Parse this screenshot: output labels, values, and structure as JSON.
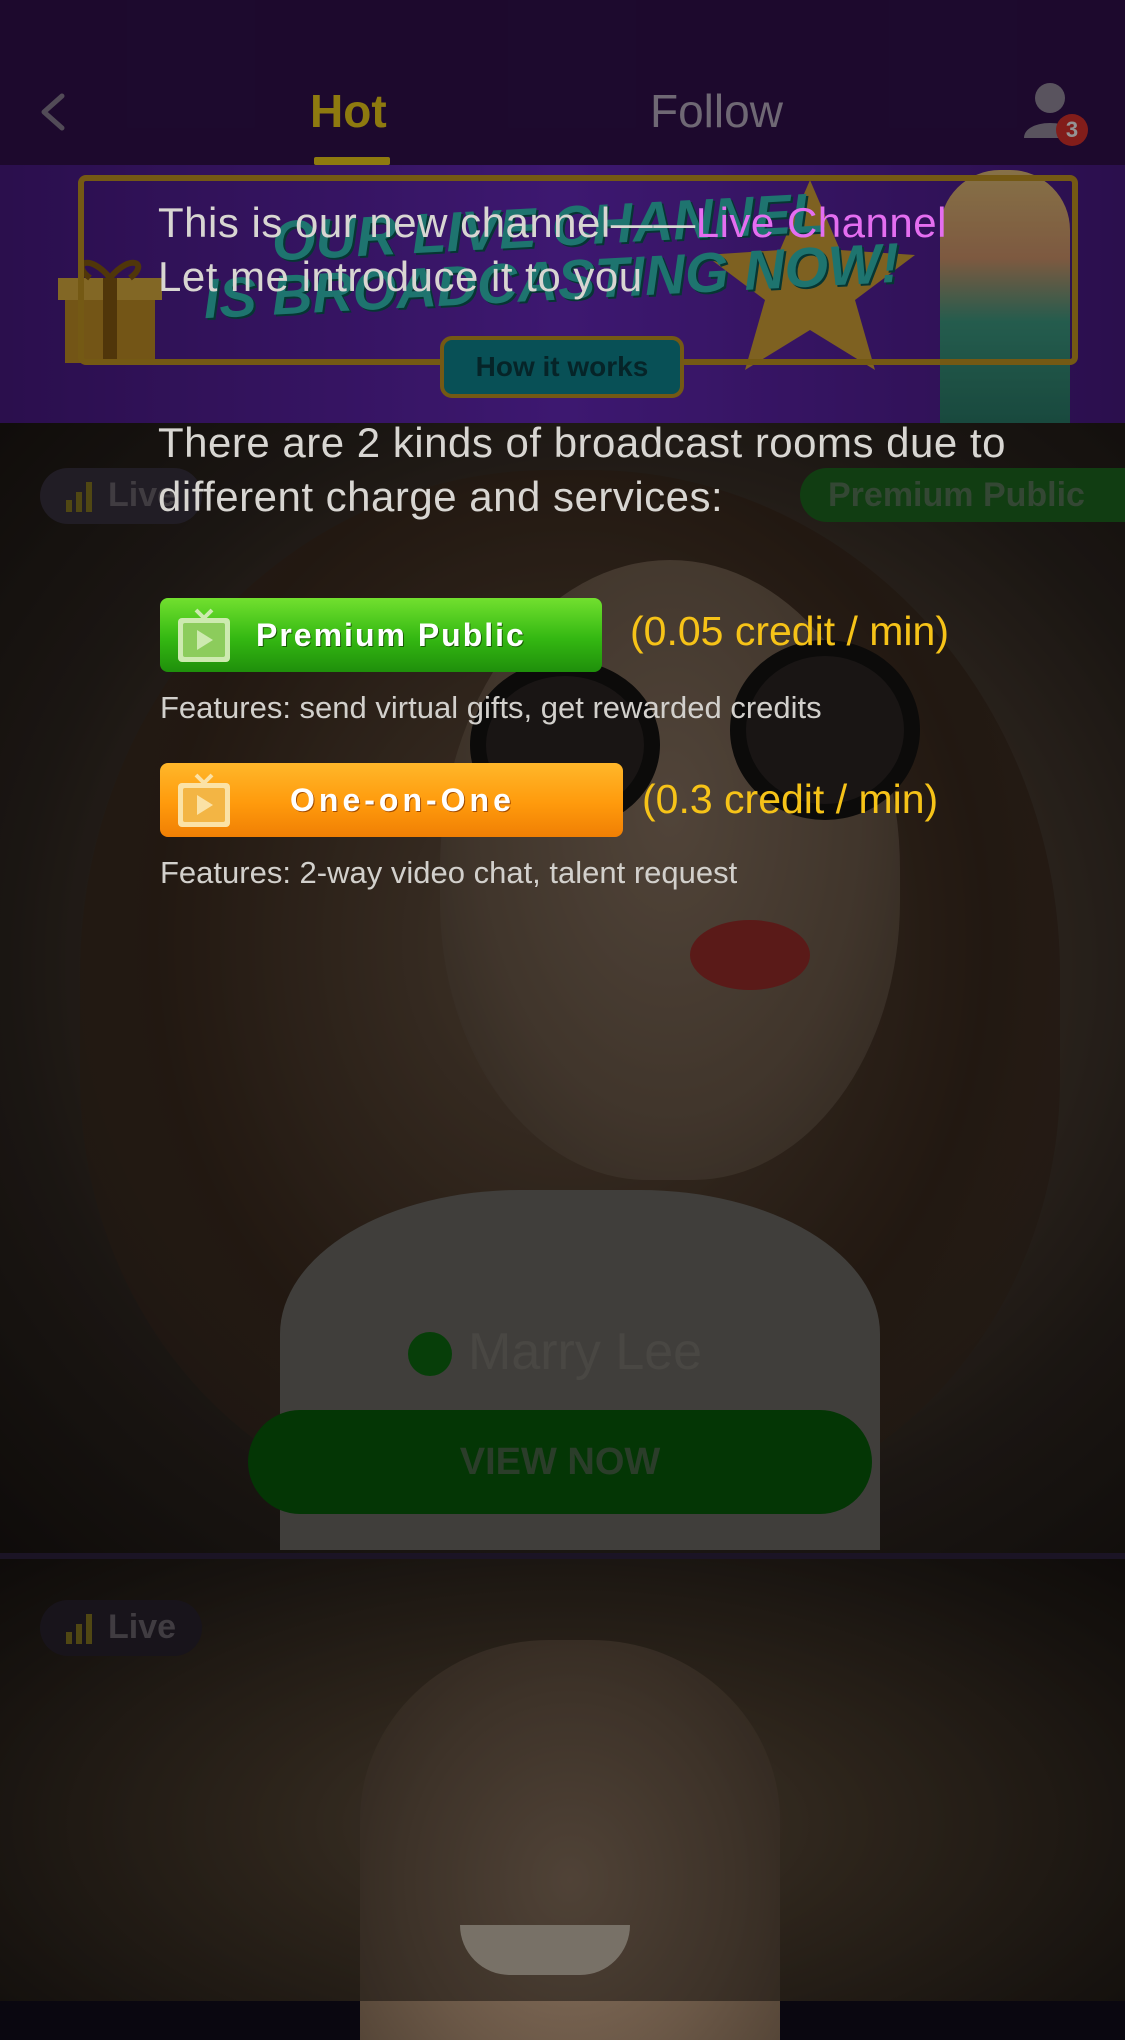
{
  "nav": {
    "tabs": [
      {
        "label": "Hot",
        "active": true
      },
      {
        "label": "Follow",
        "active": false
      }
    ],
    "notification_count": "3",
    "back_icon": "chevron-left-icon",
    "profile_icon": "user-icon"
  },
  "banner": {
    "headline_line1": "OUR LIVE CHANNEL",
    "headline_line2": "IS BROADCASTING NOW!",
    "button_label": "How it works"
  },
  "cards": [
    {
      "live_label": "Live",
      "room_tag": "Premium Public",
      "name": "Marry Lee",
      "cta": "VIEW NOW"
    },
    {
      "live_label": "Live"
    }
  ],
  "intro": {
    "line1_prefix": "This is our new channel——",
    "line1_highlight": "Live Channel",
    "line2": "Let me introduce it to you",
    "paragraph": "There are 2 kinds of broadcast rooms due to different charge and services:",
    "rooms": [
      {
        "label": "Premium Public",
        "price": "(0.05 credit / min)",
        "features": "Features: send virtual gifts, get rewarded credits",
        "color": "#34b812"
      },
      {
        "label": "One-on-One",
        "price": "(0.3 credit / min)",
        "features": "Features: 2-way video chat, talent request",
        "color": "#ff9a0c"
      }
    ]
  },
  "colors": {
    "accent_yellow": "#f4d31b",
    "highlight_pink": "#e46ef0",
    "price_yellow": "#f6c318",
    "topbar": "#32114f"
  }
}
